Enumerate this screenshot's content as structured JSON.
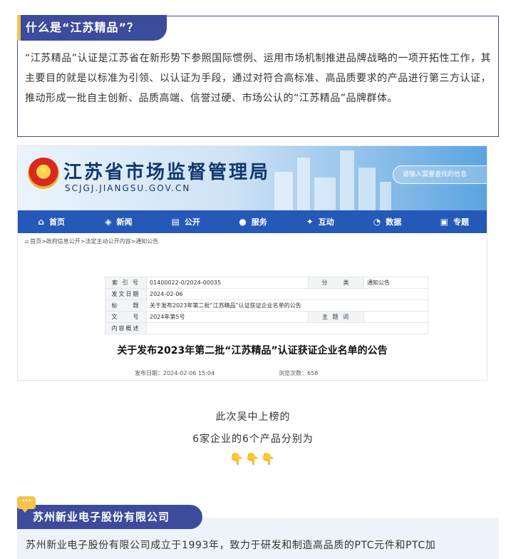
{
  "section1": {
    "tag": "什么是“江苏精品”？",
    "body": "“江苏精品”认证是江苏省在新形势下参照国际惯例、运用市场机制推进品牌战略的一项开拓性工作，其主要目的就是以标准为引领、以认证为手段，通过对符合高标准、高品质要求的产品进行第三方认证，推动形成一批自主创新、品质高端、信誉过硬、市场公认的“江苏精品”品牌群体。"
  },
  "site": {
    "title": "江苏省市场监督管理局",
    "url": "SCJGJ.JIANGSU.GOV.CN",
    "search_placeholder": "请输入需要查找的信息",
    "nav": [
      {
        "label": "首页",
        "icon": "home-icon",
        "glyph": "⌂"
      },
      {
        "label": "新闻",
        "icon": "layers-icon",
        "glyph": "◈"
      },
      {
        "label": "公开",
        "icon": "document-icon",
        "glyph": "▤"
      },
      {
        "label": "服务",
        "icon": "user-icon",
        "glyph": "●"
      },
      {
        "label": "互动",
        "icon": "handshake-icon",
        "glyph": "✦"
      },
      {
        "label": "数据",
        "icon": "pie-chart-icon",
        "glyph": "◔"
      },
      {
        "label": "专题",
        "icon": "window-icon",
        "glyph": "▣"
      }
    ],
    "breadcrumb": "首页>政府信息公开>法定主动公开内容>通知公告"
  },
  "notice": {
    "rows": [
      {
        "k1": "索 引 号",
        "v1": "01400022-0/2024-00035",
        "k2": "分　　类",
        "v2": "通知公告"
      },
      {
        "k1": "发文日期",
        "v1": "2024-02-06",
        "k2": "",
        "v2": ""
      },
      {
        "k1": "标　　题",
        "v1": "关于发布2023年第二批“江苏精品”认证获证企业名单的公告",
        "k2": "",
        "v2": ""
      },
      {
        "k1": "文　　号",
        "v1": "2024年第5号",
        "k2": "主 题 词",
        "v2": ""
      },
      {
        "k1": "内容概述",
        "v1": "",
        "k2": "",
        "v2": ""
      }
    ],
    "title": "关于发布2023年第二批“江苏精品”认证获证企业名单的公告",
    "publish_date": "发布日期：2024-02-06 15:04",
    "views": "浏览次数：658"
  },
  "center": {
    "line1": "此次吴中上榜的",
    "line2": "6家企业的6个产品分别为",
    "hands": "👇👇👇"
  },
  "company": {
    "name": "苏州新业电子股份有限公司",
    "bubble": "···",
    "body": "苏州新业电子股份有限公司成立于1993年，致力于研发和制造高品质的PTC元件和PTC加"
  }
}
